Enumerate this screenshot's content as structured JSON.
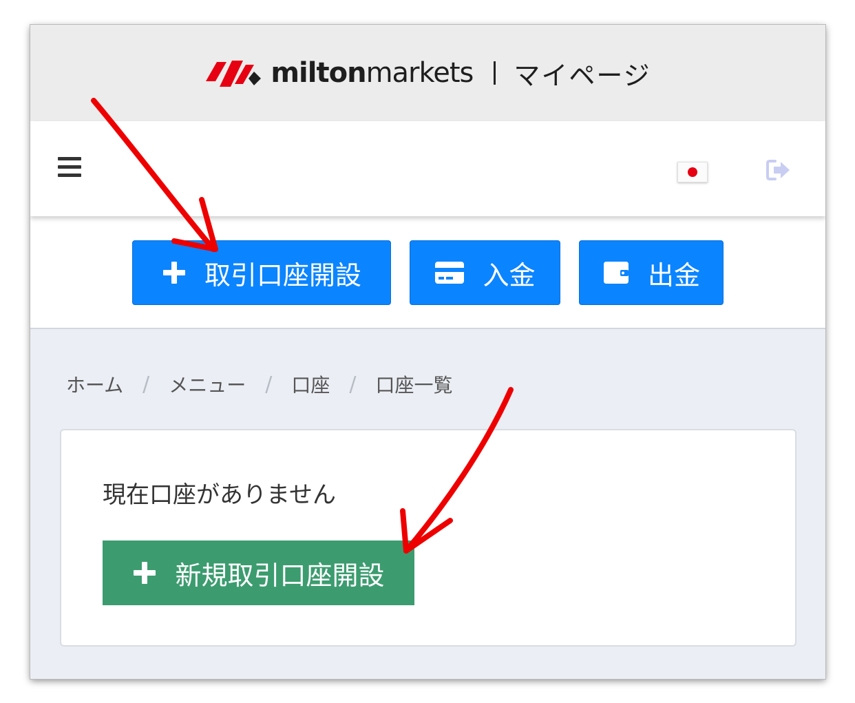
{
  "brand": {
    "name_bold": "milton",
    "name_regular": "markets",
    "page_title": "マイページ",
    "mark_color": "#e60012"
  },
  "topnav": {
    "menu_icon": "hamburger-icon",
    "language_icon": "japan-flag-icon",
    "logout_icon": "sign-out-icon"
  },
  "actions": {
    "open_account": "取引口座開設",
    "deposit": "入金",
    "withdraw": "出金",
    "button_color": "#0b84ff"
  },
  "breadcrumb": [
    "ホーム",
    "メニュー",
    "口座",
    "口座一覧"
  ],
  "accounts": {
    "empty_message": "現在口座がありません",
    "new_account_button": "新規取引口座開設",
    "button_color": "#3c9c6f"
  },
  "annotation_color": "#ee0000"
}
